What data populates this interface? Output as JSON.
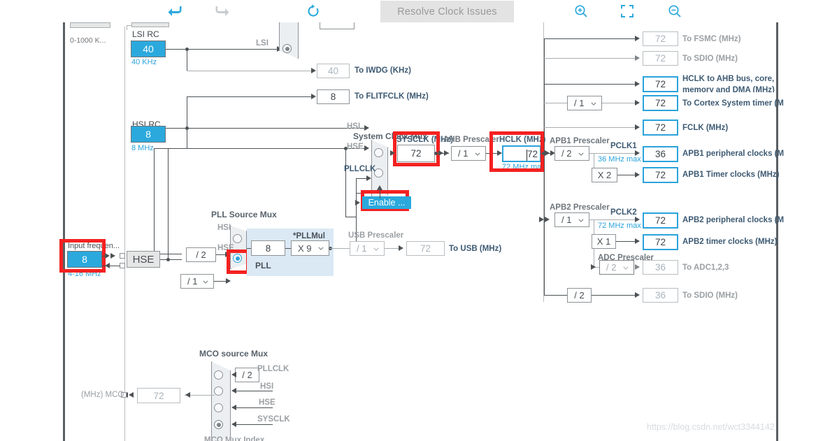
{
  "toolbar": {
    "undo_icon": "undo-arrow-icon",
    "redo_icon": "redo-arrow-icon",
    "reset_icon": "reset-circular-arrow-icon",
    "resolve_label": "Resolve Clock Issues",
    "zoom_in_icon": "zoom-in-icon",
    "fit_icon": "fit-to-screen-icon",
    "zoom_out_icon": "zoom-out-icon"
  },
  "colors": {
    "accent_blue": "#2ba9dd",
    "highlight_red": "#f42121",
    "panel_blue": "#dbe9f5",
    "label_dark": "#3d5a73",
    "label_gray": "#9ba0a4"
  },
  "sources": {
    "lse_range": "0-1000 K...",
    "lsi_rc_title": "LSI RC",
    "lsi_rc_value": "40",
    "lsi_rc_unit": "40 KHz",
    "lsi_wire_label": "LSI",
    "hsi_rc_title": "HSI RC",
    "hsi_rc_value": "8",
    "hsi_rc_unit": "8 MHz",
    "input_freq_title": "Input frequen...",
    "input_freq_value": "8",
    "input_freq_unit": "4-16 MHz",
    "hse_label": "HSE"
  },
  "outputs": {
    "iwdg_value": "40",
    "iwdg_label": "To IWDG (KHz)",
    "flitfclk_value": "8",
    "flitfclk_label": "To FLITFCLK (MHz)"
  },
  "pll": {
    "source_mux_title": "PLL Source Mux",
    "hsi_div_label": "/ 2",
    "hsi_port": "HSI",
    "hse_div_label": "/ 1",
    "hse_port": "HSE",
    "pll_label": "PLL",
    "pll_input_value": "8",
    "pllmul_title": "*PLLMul",
    "pllmul_value": "X 9"
  },
  "system_mux": {
    "title": "System Clock Mux",
    "port_hsi": "HSI",
    "port_hse": "HSE",
    "port_pllclk": "PLLCLK",
    "enable_label": "Enable ...",
    "sysclk_title": "SYSCLK (MHz)",
    "sysclk_value": "72"
  },
  "ahb": {
    "prescaler_title": "AHB Prescaler",
    "prescaler_value": "/ 1",
    "hclk_title": "HCLK (MHz)",
    "hclk_value": "72",
    "hclk_max": "72 MHz max"
  },
  "usb": {
    "prescaler_title": "USB Prescaler",
    "prescaler_value": "/ 1",
    "out_value": "72",
    "out_label": "To USB (MHz)"
  },
  "ahb_outputs": [
    {
      "value": "72",
      "label": "To FSMC (MHz)",
      "style": "dim"
    },
    {
      "value": "72",
      "label": "To SDIO (MHz)",
      "style": "dim"
    },
    {
      "value": "72",
      "label": "HCLK to AHB bus, core,",
      "label2": "memory and DMA (MHz)",
      "style": "sel"
    },
    {
      "value": "72",
      "label": "To Cortex System timer (M",
      "style": "sel"
    },
    {
      "value": "72",
      "label": "FCLK (MHz)",
      "style": "sel"
    }
  ],
  "cortex_prescaler": "/ 1",
  "apb1": {
    "prescaler_title": "APB1 Prescaler",
    "prescaler_value": "/ 2",
    "pclk_name": "PCLK1",
    "pclk_max": "36 MHz max",
    "periph_value": "36",
    "periph_label": "APB1 peripheral clocks (M",
    "timer_mul": "X 2",
    "timer_value": "72",
    "timer_label": "APB1 Timer clocks (MHz)"
  },
  "apb2": {
    "prescaler_title": "APB2 Prescaler",
    "prescaler_value": "/ 1",
    "pclk_name": "PCLK2",
    "pclk_max": "72 MHz max",
    "periph_value": "72",
    "periph_label": "APB2 peripheral clocks (M",
    "timer_mul": "X 1",
    "timer_value": "72",
    "timer_label": "APB2 timer clocks (MHz)",
    "adc_prescaler_title": "ADC Prescaler",
    "adc_prescaler_value": "/ 2",
    "adc_value": "36",
    "adc_label": "To ADC1,2,3"
  },
  "sdio2": {
    "div_value": "/ 2",
    "value": "36",
    "label": "To SDIO (MHz)"
  },
  "mco": {
    "title": "MCO source Mux",
    "pin_label": "(MHz) MCO",
    "value": "72",
    "div_label": "/ 2",
    "src_pllclk": "PLLCLK",
    "src_hsi": "HSI",
    "src_hse": "HSE",
    "src_sysclk": "SYSCLK"
  },
  "watermark": "https://blog.csdn.net/wct3344142"
}
